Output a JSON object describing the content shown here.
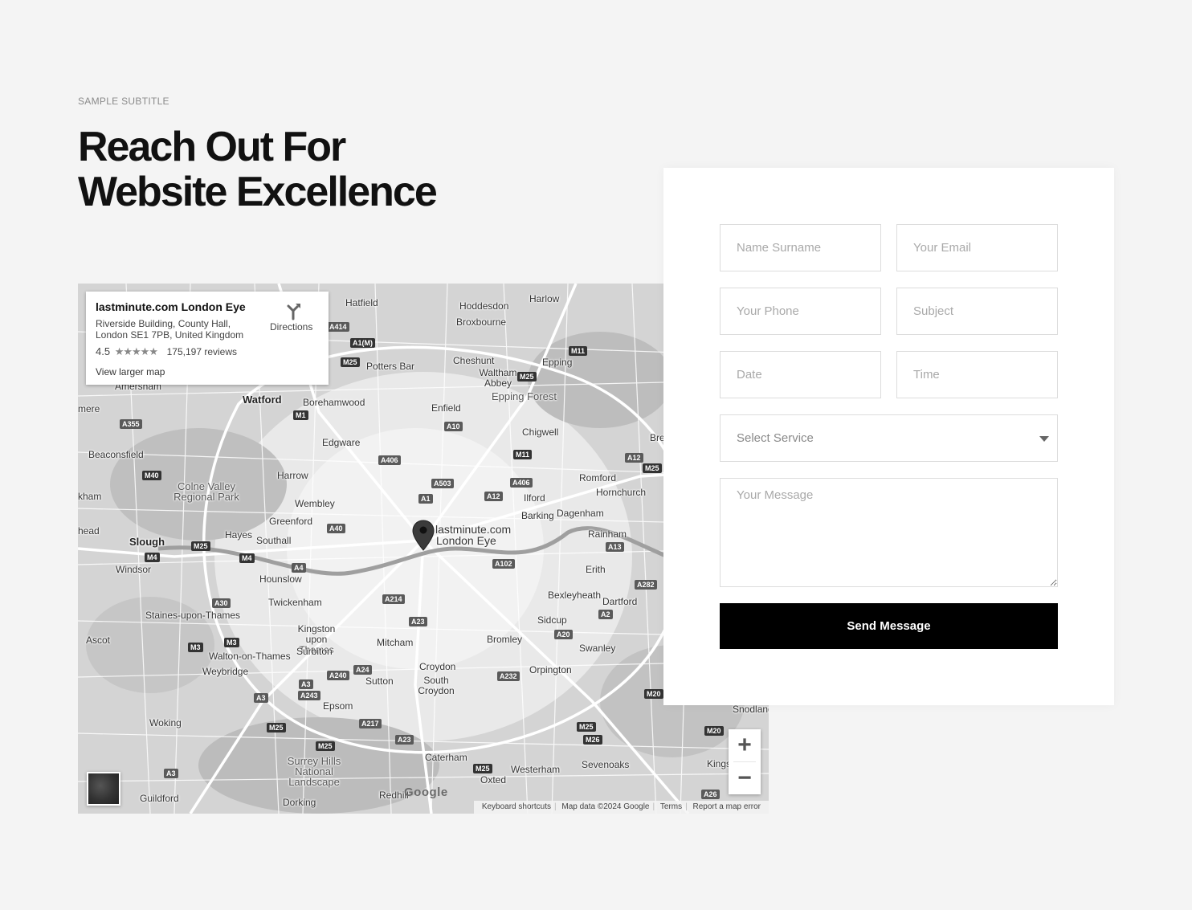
{
  "header": {
    "subtitle": "SAMPLE SUBTITLE",
    "title_line1": "Reach Out For",
    "title_line2": "Website Excellence"
  },
  "map": {
    "place_card": {
      "title": "lastminute.com London Eye",
      "address_line1": "Riverside Building, County Hall,",
      "address_line2": "London SE1 7PB, United Kingdom",
      "rating": "4.5",
      "stars": "★★★★★",
      "reviews": "175,197 reviews",
      "larger_map_link": "View larger map",
      "directions_label": "Directions",
      "directions_icon": "directions-icon"
    },
    "pin_label_line1": "lastminute.com",
    "pin_label_line2": "London Eye",
    "places": {
      "hatfield": "Hatfield",
      "hoddesdon": "Hoddesdon",
      "harlow": "Harlow",
      "broxbourne": "Broxbourne",
      "cheshunt": "Cheshunt",
      "waltham_abbey": "Waltham Abbey",
      "epping": "Epping",
      "epping_forest": "Epping Forest",
      "potters_bar": "Potters Bar",
      "amersham": "Amersham",
      "watford": "Watford",
      "borehamwood": "Borehamwood",
      "enfield": "Enfield",
      "rickmansworth": "mere",
      "beaconsfield": "Beaconsfield",
      "edgware": "Edgware",
      "chigwell": "Chigwell",
      "brentwood": "Bre",
      "colne_valley": "Colne Valley Regional Park",
      "harrow": "Harrow",
      "romford": "Romford",
      "hornchurch": "Hornchurch",
      "ilford": "Ilford",
      "barking": "Barking",
      "dagenham": "Dagenham",
      "wembley": "Wembley",
      "greenford": "Greenford",
      "slough": "Slough",
      "hayes": "Hayes",
      "southall": "Southall",
      "rainham": "Rainham",
      "windsor": "Windsor",
      "hounslow": "Hounslow",
      "erith": "Erith",
      "twickenham": "Twickenham",
      "bexleyheath": "Bexleyheath",
      "dartford": "Dartford",
      "staines": "Staines-upon-Thames",
      "kingston": "Kingston upon Thames",
      "sidcup": "Sidcup",
      "ascot": "Ascot",
      "mitcham": "Mitcham",
      "bromley": "Bromley",
      "swanley": "Swanley",
      "surbiton": "Surbiton",
      "walton": "Walton-on-Thames",
      "weybridge": "Weybridge",
      "croydon": "Croydon",
      "orpington": "Orpington",
      "sutton": "Sutton",
      "south_croydon": "South Croydon",
      "epsom": "Epsom",
      "snodland": "Snodland",
      "woking": "Woking",
      "surrey_hills": "Surrey Hills National Landscape",
      "caterham": "Caterham",
      "westerham": "Westerham",
      "sevenoaks": "Sevenoaks",
      "oxted": "Oxted",
      "guildford": "Guildford",
      "dorking": "Dorking",
      "redhill": "Redhill",
      "kings": "Kings",
      "chalk": "ham",
      "slough_left": "head",
      "left_edge_a": "kham"
    },
    "roads": {
      "a414": "A414",
      "a1m": "A1(M)",
      "m25_n": "M25",
      "m11_n": "M11",
      "m25_ne": "M25",
      "m1": "M1",
      "a10": "A10",
      "a355": "A355",
      "a406_w": "A406",
      "m11": "M11",
      "a12": "A12",
      "m25_e": "M25",
      "m40": "M40",
      "a503": "A503",
      "a406_e": "A406",
      "a1": "A1",
      "a12_c": "A12",
      "a40": "A40",
      "m25_w": "M25",
      "m4_w": "M4",
      "m4_e": "M4",
      "a4": "A4",
      "a13": "A13",
      "a102": "A102",
      "a282": "A282",
      "a30": "A30",
      "a214": "A214",
      "a23_n": "A23",
      "a2": "A2",
      "a20": "A20",
      "m3_w": "M3",
      "m3_e": "M3",
      "a24": "A24",
      "a240": "A240",
      "a3": "A3",
      "a243": "A243",
      "a232": "A232",
      "a3_s": "A3",
      "m20": "M20",
      "m25_s": "M25",
      "a217": "A217",
      "m25_sw": "M25",
      "a23_s": "A23",
      "m25_se": "M25",
      "m26": "M26",
      "m20_e": "M20",
      "a3_g": "A3",
      "m25_r": "M25",
      "a26": "A26"
    },
    "google_mark": "Google",
    "attribution": {
      "shortcuts": "Keyboard shortcuts",
      "data": "Map data ©2024 Google",
      "terms": "Terms",
      "report": "Report a map error"
    },
    "zoom_in": "+",
    "zoom_out": "−"
  },
  "form": {
    "name_placeholder": "Name Surname",
    "email_placeholder": "Your Email",
    "phone_placeholder": "Your Phone",
    "subject_placeholder": "Subject",
    "date_placeholder": "Date",
    "time_placeholder": "Time",
    "service_selected": "Select Service",
    "message_placeholder": "Your Message",
    "submit_label": "Send Message"
  }
}
